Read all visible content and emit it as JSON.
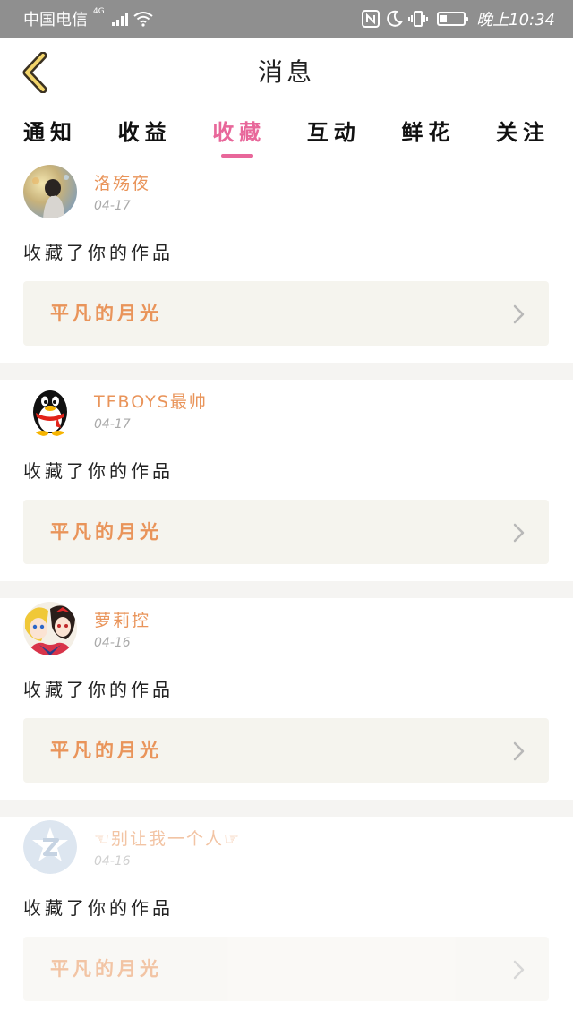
{
  "status_bar": {
    "carrier": "中国电信",
    "network": "4G",
    "time": "晚上10:34",
    "battery_level": 0.3
  },
  "header": {
    "title": "消息"
  },
  "tabs": [
    {
      "label": "通知",
      "active": false
    },
    {
      "label": "收益",
      "active": false
    },
    {
      "label": "收藏",
      "active": true
    },
    {
      "label": "互动",
      "active": false
    },
    {
      "label": "鲜花",
      "active": false
    },
    {
      "label": "关注",
      "active": false
    }
  ],
  "feed": [
    {
      "user": "洛殇夜",
      "date": "04-17",
      "action": "收藏了你的作品",
      "work": "平凡的月光",
      "avatar": "girl-photo-avatar"
    },
    {
      "user": "TFBOYS最帅",
      "date": "04-17",
      "action": "收藏了你的作品",
      "work": "平凡的月光",
      "avatar": "penguin-avatar"
    },
    {
      "user": "萝莉控",
      "date": "04-16",
      "action": "收藏了你的作品",
      "work": "平凡的月光",
      "avatar": "anime-avatar"
    },
    {
      "user": "☜别让我一个人☞",
      "date": "04-16",
      "action": "收藏了你的作品",
      "work": "平凡的月光",
      "avatar": "default-z-avatar"
    }
  ],
  "colors": {
    "accent": "#e8679a",
    "name": "#e9945a",
    "work_bg": "#f5f4ee",
    "status_bg": "#8f8f8f"
  }
}
